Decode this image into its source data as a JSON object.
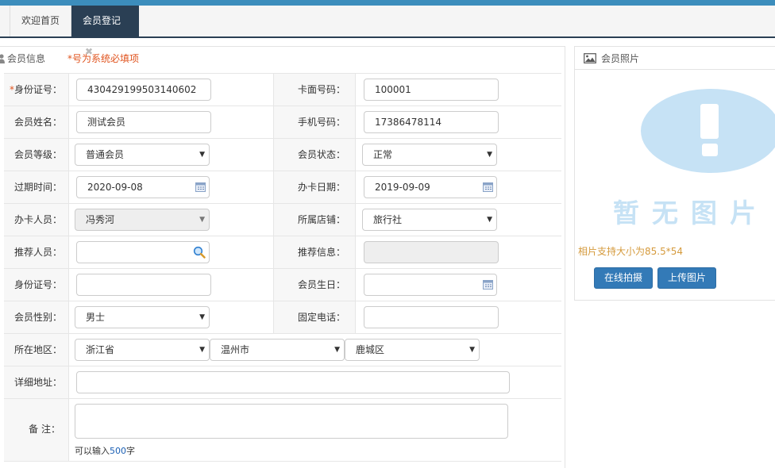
{
  "tabs": {
    "home": "欢迎首页",
    "active": "会员登记",
    "close_glyph": "✖"
  },
  "panel": {
    "title": "会员信息",
    "required_note": "*号为系统必填项"
  },
  "form": {
    "id_no_label_star": "*",
    "id_no_label": "身份证号：",
    "id_no_value": "430429199503140602",
    "card_no_label": "卡面号码：",
    "card_no_value": "100001",
    "name_label": "会员姓名：",
    "name_value": "测试会员",
    "phone_label": "手机号码：",
    "phone_value": "17386478114",
    "level_label": "会员等级：",
    "level_value": "普通会员",
    "status_label": "会员状态：",
    "status_value": "正常",
    "expire_label": "过期时间：",
    "expire_value": "2020-09-08",
    "card_date_label": "办卡日期：",
    "card_date_value": "2019-09-09",
    "staff_label": "办卡人员：",
    "staff_value": "冯秀河",
    "store_label": "所属店铺：",
    "store_value": "旅行社",
    "referrer_label": "推荐人员：",
    "referrer_value": "",
    "referrer_info_label": "推荐信息：",
    "referrer_info_value": "",
    "id_no2_label": "身份证号：",
    "id_no2_value": "",
    "birthday_label": "会员生日：",
    "birthday_value": "",
    "gender_label": "会员性别：",
    "gender_value": "男士",
    "landline_label": "固定电话：",
    "landline_value": "",
    "region_label": "所在地区：",
    "province_value": "浙江省",
    "city_value": "温州市",
    "district_value": "鹿城区",
    "address_label": "详细地址：",
    "address_value": "",
    "remark_label": "备 注：",
    "remark_value": "",
    "hint_prefix": "可以输入",
    "hint_count": "500",
    "hint_suffix": "字"
  },
  "photo": {
    "title": "会员照片",
    "no_image_text": "暂无图片",
    "size_hint": "相片支持大小为85.5*54",
    "capture_button": "在线拍摄",
    "upload_button": "上传图片"
  },
  "colors": {
    "accent": "#3c8dbc",
    "tab_active": "#2a3f54",
    "button": "#337ab7",
    "required": "#e0541f",
    "placeholder_blue": "#c6e2f5"
  }
}
